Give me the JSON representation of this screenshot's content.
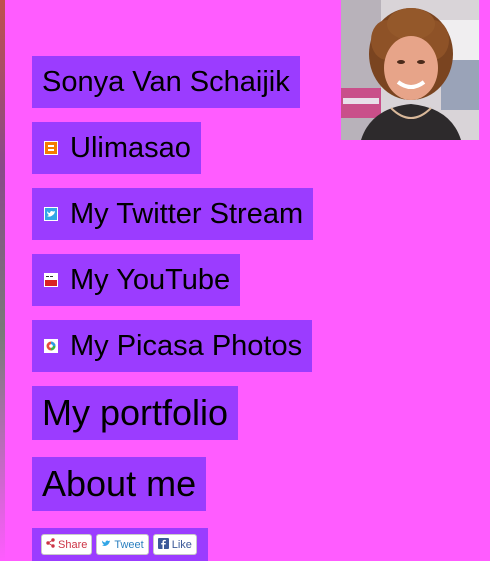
{
  "profile": {
    "name": "Sonya Van Schaijik"
  },
  "nav": {
    "ulimasao": "Ulimasao",
    "twitter": "My Twitter Stream",
    "youtube": "My YouTube",
    "picasa": "My Picasa Photos",
    "portfolio": "My portfolio",
    "about": "About me"
  },
  "share": {
    "share_label": "Share",
    "tweet_label": "Tweet",
    "like_label": "Like"
  },
  "icons": {
    "ulimasao": "blogger-icon",
    "twitter": "twitter-icon",
    "youtube": "youtube-icon",
    "picasa": "picasa-icon"
  },
  "colors": {
    "background": "#ff5cff",
    "nav_item": "#9b3cff"
  }
}
